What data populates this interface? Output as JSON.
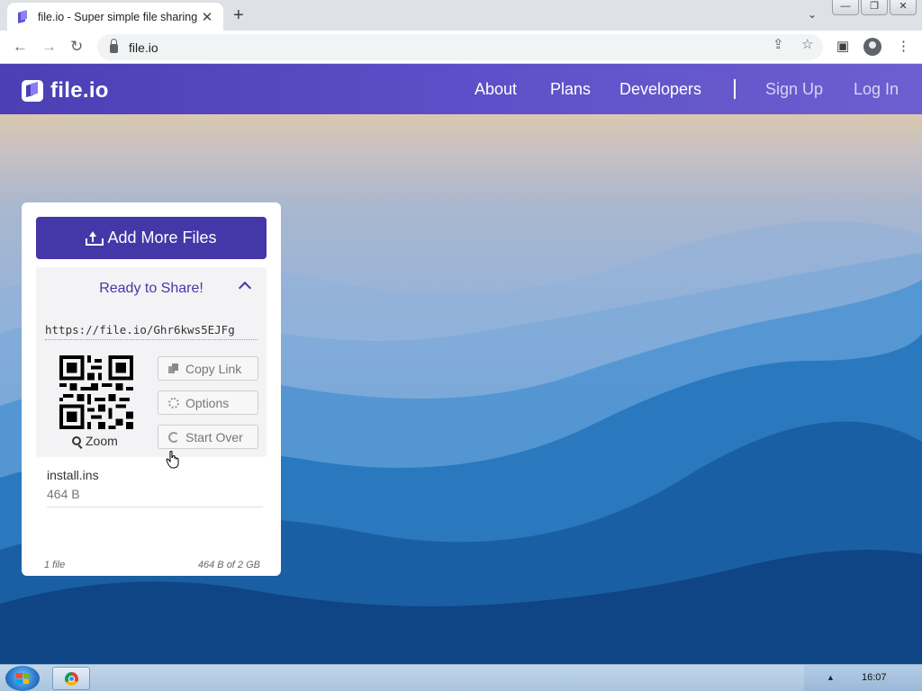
{
  "browser": {
    "tab_title": "file.io - Super simple file sharing",
    "tab_close": "✕",
    "new_tab": "+",
    "tab_search": "⌄",
    "window_buttons": [
      "—",
      "❐",
      "✕"
    ],
    "url": "file.io",
    "nav": {
      "back": "←",
      "forward": "→",
      "reload": "↻"
    },
    "omnibox_icons": {
      "share": "⇪",
      "bookmark": "☆"
    },
    "toolbar_icons": {
      "side_panel": "▣",
      "menu": "⋮"
    }
  },
  "site": {
    "logo": "file.io",
    "nav": [
      "About",
      "Plans",
      "Developers"
    ],
    "auth": [
      "Sign Up",
      "Log In"
    ]
  },
  "card": {
    "add_button": "Add More Files",
    "status": "Ready to Share!",
    "share_link": "https://file.io/Ghr6kws5EJFg",
    "zoom_label": "Zoom",
    "actions": {
      "copy": "Copy Link",
      "options": "Options",
      "start_over": "Start Over"
    },
    "file": {
      "name": "install.ins",
      "size": "464 B"
    },
    "footer": {
      "count": "1 file",
      "usage": "464 B of 2 GB"
    }
  },
  "taskbar": {
    "clock": "16:07",
    "tray_arrow": "▲"
  },
  "colors": {
    "brand": "#4437a8",
    "header": "#5d4fc7"
  }
}
